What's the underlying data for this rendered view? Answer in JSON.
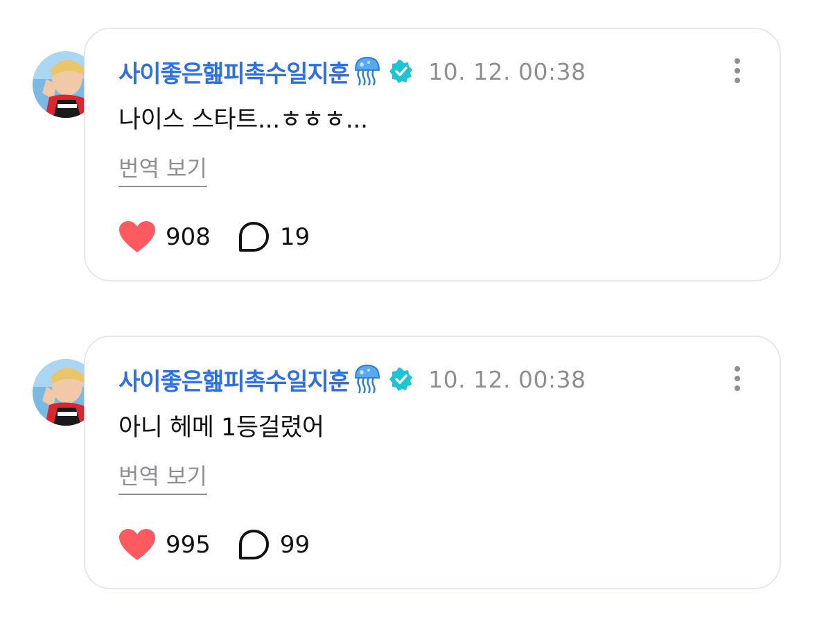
{
  "colors": {
    "username": "#2f6fe6",
    "verified": "#1ec3d6",
    "like": "#ff5a5f",
    "muted": "#8e8e93",
    "card_border": "#e6e8ef"
  },
  "posts": [
    {
      "username": "사이좋은햂피촉수일지훈",
      "username_emoji_icon": "jellyfish-icon",
      "verified_icon": "verified-badge-icon",
      "timestamp": "10. 12. 00:38",
      "text": "나이스 스타트...ㅎㅎㅎ...",
      "translate_label": "번역 보기",
      "likes": "908",
      "comments": "19"
    },
    {
      "username": "사이좋은햂피촉수일지훈",
      "username_emoji_icon": "jellyfish-icon",
      "verified_icon": "verified-badge-icon",
      "timestamp": "10. 12. 00:38",
      "text": "아니 헤메 1등걸렸어",
      "translate_label": "번역 보기",
      "likes": "995",
      "comments": "99"
    }
  ]
}
